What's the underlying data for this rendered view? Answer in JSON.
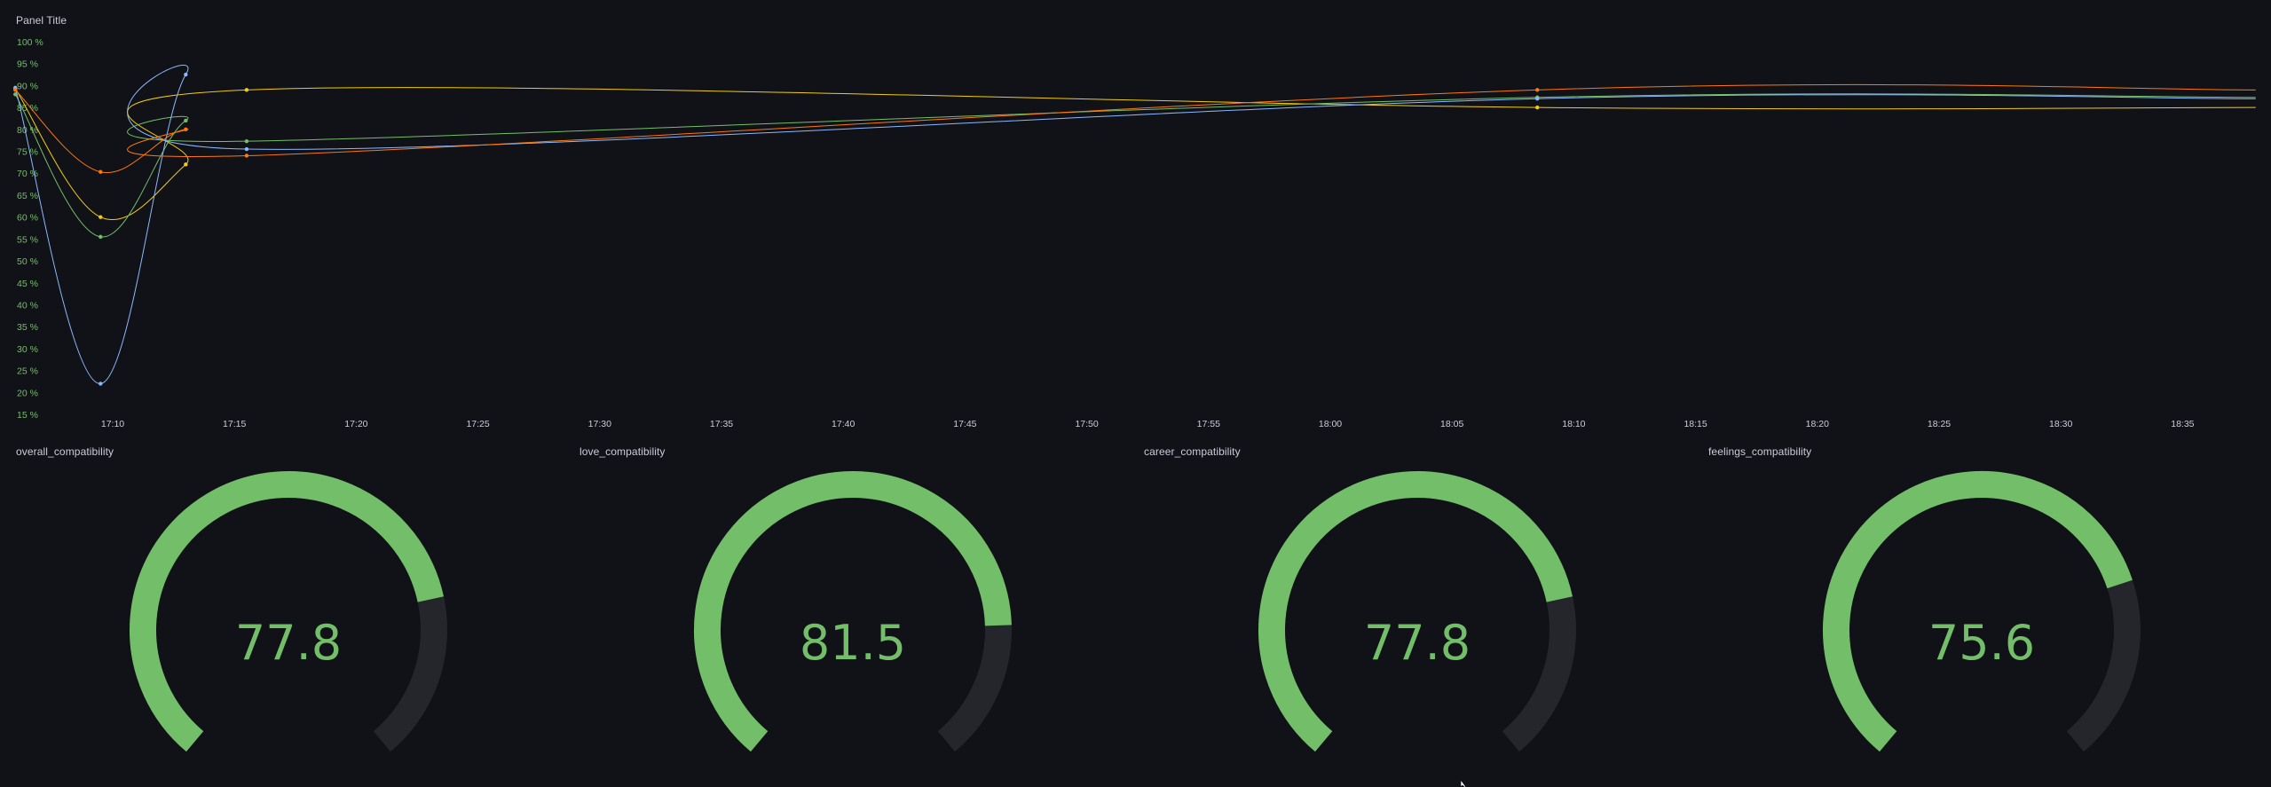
{
  "timeseries_panel": {
    "title": "Panel Title"
  },
  "chart_data": {
    "type": "line",
    "title": "Panel Title",
    "ylim": [
      15,
      100
    ],
    "y_ticks": [
      "15 %",
      "20 %",
      "25 %",
      "30 %",
      "35 %",
      "40 %",
      "45 %",
      "50 %",
      "55 %",
      "60 %",
      "65 %",
      "70 %",
      "75 %",
      "80 %",
      "85 %",
      "90 %",
      "95 %",
      "100 %"
    ],
    "x_ticks": [
      "17:10",
      "17:15",
      "17:20",
      "17:25",
      "17:30",
      "17:35",
      "17:40",
      "17:45",
      "17:50",
      "17:55",
      "18:00",
      "18:05",
      "18:10",
      "18:15",
      "18:20",
      "18:25",
      "18:30",
      "18:35"
    ],
    "legend": "none",
    "grid": false,
    "series": [
      {
        "color": "#f2cc0c",
        "x": [
          "17:06",
          "17:09:30",
          "17:13",
          "17:15:30",
          "18:08:30",
          "18:38"
        ],
        "values": [
          89.3,
          60,
          72,
          89,
          85,
          85
        ]
      },
      {
        "color": "#73bf69",
        "x": [
          "17:06",
          "17:09:30",
          "17:13",
          "17:15:30",
          "18:08:30",
          "18:38"
        ],
        "values": [
          88,
          55.5,
          82,
          77.3,
          87.3,
          87.3
        ]
      },
      {
        "color": "#8ab8ff",
        "x": [
          "17:06",
          "17:09:30",
          "17:13",
          "17:15:30",
          "18:08:30",
          "18:38"
        ],
        "values": [
          89.5,
          22,
          92.5,
          75.5,
          87,
          87
        ]
      },
      {
        "color": "#ff780a",
        "x": [
          "17:06",
          "17:09:30",
          "17:13",
          "17:15:30",
          "18:08:30",
          "18:38"
        ],
        "values": [
          89,
          70.3,
          80,
          74,
          89,
          89
        ]
      }
    ]
  },
  "gauges": [
    {
      "title": "overall_compatibility",
      "value": "77.8",
      "fraction": 0.778
    },
    {
      "title": "love_compatibility",
      "value": "81.5",
      "fraction": 0.815
    },
    {
      "title": "career_compatibility",
      "value": "77.8",
      "fraction": 0.778
    },
    {
      "title": "feelings_compatibility",
      "value": "75.6",
      "fraction": 0.756
    }
  ],
  "colors": {
    "background": "#111217",
    "gauge_fill": "#73bf69",
    "gauge_track": "#25262b",
    "text": "#ccccdc"
  }
}
